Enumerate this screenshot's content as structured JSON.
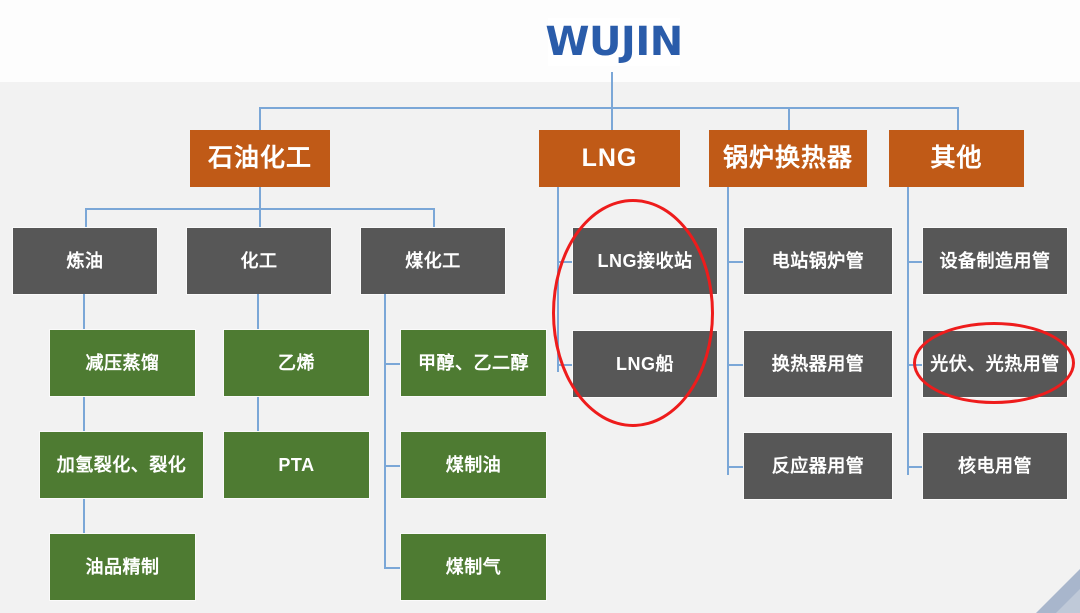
{
  "brand": {
    "logo_text": "WUJIN",
    "logo_color": "#2a5caa"
  },
  "colors": {
    "level1": "#c05a17",
    "level2": "#575757",
    "level3": "#4e7b32",
    "connector": "#7ba7d7",
    "highlight": "#ee1c1c",
    "background": "#f2f2f2"
  },
  "diagram": {
    "type": "org-hierarchy-tree",
    "root": "WUJIN",
    "branches": [
      {
        "label": "石油化工",
        "children": [
          {
            "label": "炼油",
            "children": [
              {
                "label": "减压蒸馏"
              },
              {
                "label": "加氢裂化、裂化"
              },
              {
                "label": "油品精制"
              }
            ]
          },
          {
            "label": "化工",
            "children": [
              {
                "label": "乙烯"
              },
              {
                "label": "PTA"
              }
            ]
          },
          {
            "label": "煤化工",
            "children": [
              {
                "label": "甲醇、乙二醇"
              },
              {
                "label": "煤制油"
              },
              {
                "label": "煤制气"
              }
            ]
          }
        ]
      },
      {
        "label": "LNG",
        "children": [
          {
            "label": "LNG接收站",
            "highlighted": true
          },
          {
            "label": "LNG船",
            "highlighted": true
          }
        ]
      },
      {
        "label": "锅炉换热器",
        "children": [
          {
            "label": "电站锅炉管"
          },
          {
            "label": "换热器用管"
          },
          {
            "label": "反应器用管"
          }
        ]
      },
      {
        "label": "其他",
        "children": [
          {
            "label": "设备制造用管"
          },
          {
            "label": "光伏、光热用管",
            "highlighted": true
          },
          {
            "label": "核电用管"
          }
        ]
      }
    ]
  },
  "nodes": {
    "root": "WUJIN",
    "l1_petrochem": "石油化工",
    "l1_lng": "LNG",
    "l1_boiler": "锅炉换热器",
    "l1_other": "其他",
    "l2_refining": "炼油",
    "l2_chemical": "化工",
    "l2_coalchem": "煤化工",
    "l2_lng_terminal": "LNG接收站",
    "l2_lng_ship": "LNG船",
    "l2_power_boiler": "电站锅炉管",
    "l2_heat_exchanger": "换热器用管",
    "l2_reactor": "反应器用管",
    "l2_equipment": "设备制造用管",
    "l2_solar": "光伏、光热用管",
    "l2_nuclear": "核电用管",
    "l3_vacuum_distill": "减压蒸馏",
    "l3_hydrocracking": "加氢裂化、裂化",
    "l3_oil_refine": "油品精制",
    "l3_ethylene": "乙烯",
    "l3_pta": "PTA",
    "l3_methanol": "甲醇、乙二醇",
    "l3_coal_oil": "煤制油",
    "l3_coal_gas": "煤制气"
  }
}
